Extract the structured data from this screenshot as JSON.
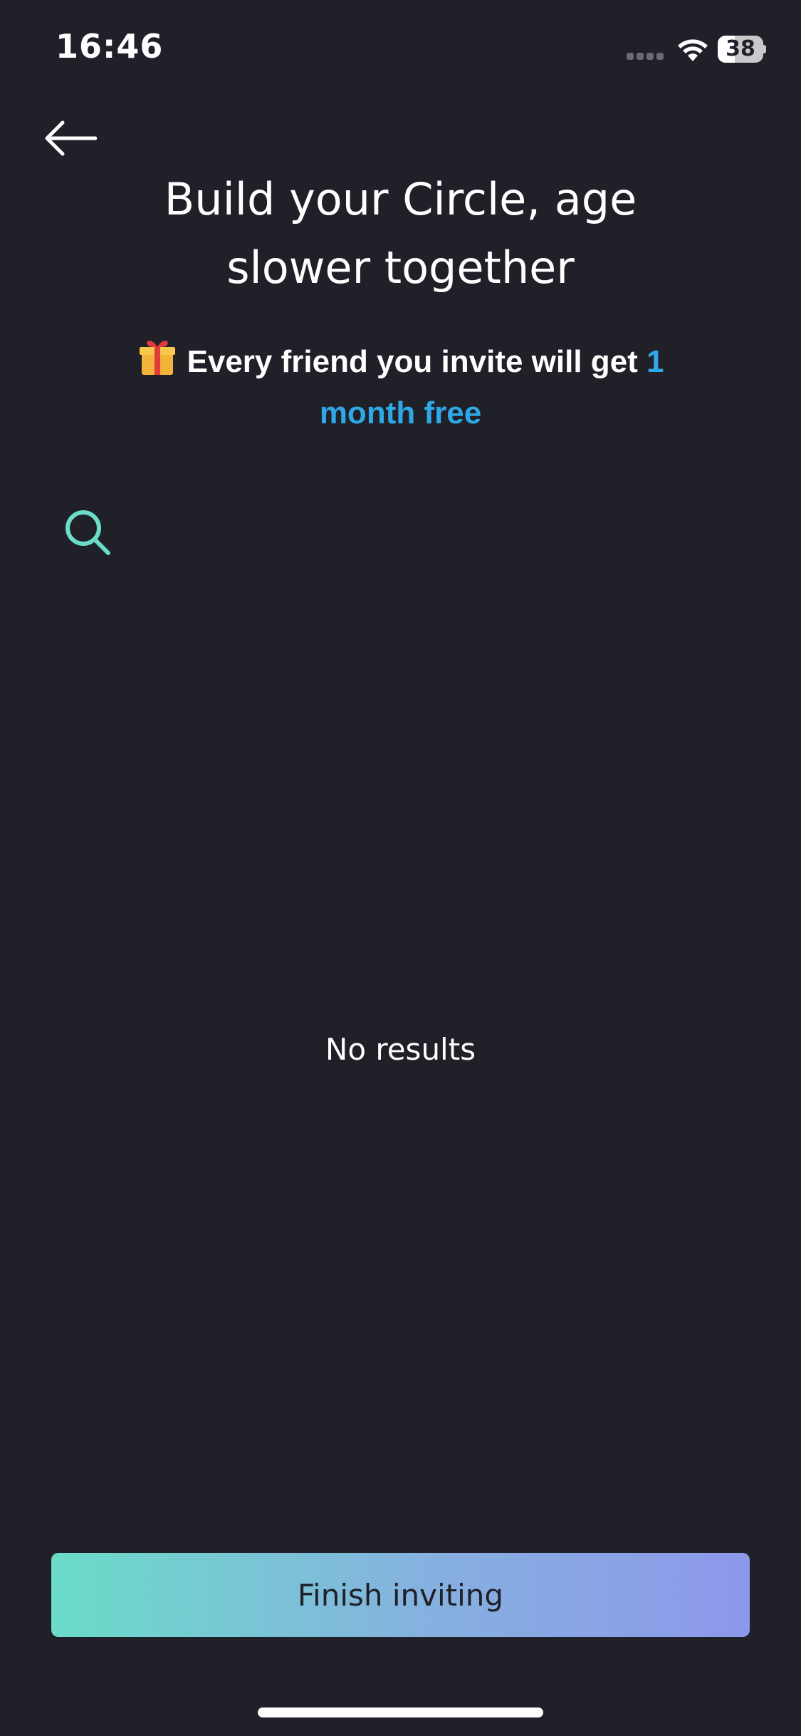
{
  "status_bar": {
    "time": "16:46",
    "battery": "38",
    "battery_level_percent": 38
  },
  "header": {
    "title_line1": "Build your Circle, age",
    "title_line2": "slower together",
    "subtitle_prefix": "Every friend you invite will get ",
    "subtitle_highlight": "1 month free"
  },
  "search": {
    "value": "",
    "placeholder": ""
  },
  "empty_state": {
    "text": "No results"
  },
  "footer": {
    "finish_label": "Finish inviting"
  },
  "colors": {
    "background": "#1f2028",
    "accent_teal": "#6bdcc8",
    "accent_blue": "#2ea8e6",
    "gradient_end": "#8d98ea"
  },
  "icons": {
    "back": "arrow-left-icon",
    "gift": "gift-icon",
    "search": "search-icon",
    "wifi": "wifi-icon",
    "signal": "signal-icon",
    "battery": "battery-icon"
  }
}
